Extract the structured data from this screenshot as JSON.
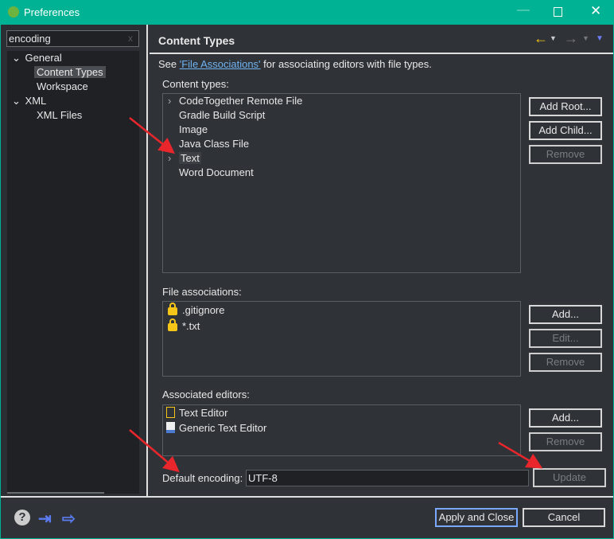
{
  "window": {
    "title": "Preferences",
    "accent": "#00b294"
  },
  "sidebar": {
    "search_value": "encoding",
    "tree": [
      {
        "label": "General",
        "expanded": true,
        "children": [
          "Content Types",
          "Workspace"
        ]
      },
      {
        "label": "XML",
        "expanded": true,
        "children": [
          "XML Files"
        ]
      }
    ],
    "selected": "Content Types"
  },
  "page": {
    "title": "Content Types",
    "intro_prefix": "See ",
    "intro_link": "'File Associations'",
    "intro_suffix": " for associating editors with file types.",
    "content_types_label": "Content types:",
    "content_types": [
      {
        "label": "CodeTogether Remote File",
        "expandable": true
      },
      {
        "label": "Gradle Build Script",
        "expandable": false
      },
      {
        "label": "Image",
        "expandable": false
      },
      {
        "label": "Java Class File",
        "expandable": false
      },
      {
        "label": "Text",
        "expandable": true,
        "selected": true
      },
      {
        "label": "Word Document",
        "expandable": false
      }
    ],
    "content_buttons": {
      "add_root": "Add Root...",
      "add_child": "Add Child...",
      "remove": "Remove"
    },
    "file_assoc_label": "File associations:",
    "file_assoc": [
      ".gitignore",
      "*.txt"
    ],
    "file_buttons": {
      "add": "Add...",
      "edit": "Edit...",
      "remove": "Remove"
    },
    "editors_label": "Associated editors:",
    "editors": [
      "Text Editor",
      "Generic Text Editor"
    ],
    "editor_buttons": {
      "add": "Add...",
      "remove": "Remove"
    },
    "encoding_label": "Default encoding:",
    "encoding_value": "UTF-8",
    "update": "Update"
  },
  "footer": {
    "apply_close": "Apply and Close",
    "cancel": "Cancel"
  },
  "annotation_color": "#e8262b"
}
